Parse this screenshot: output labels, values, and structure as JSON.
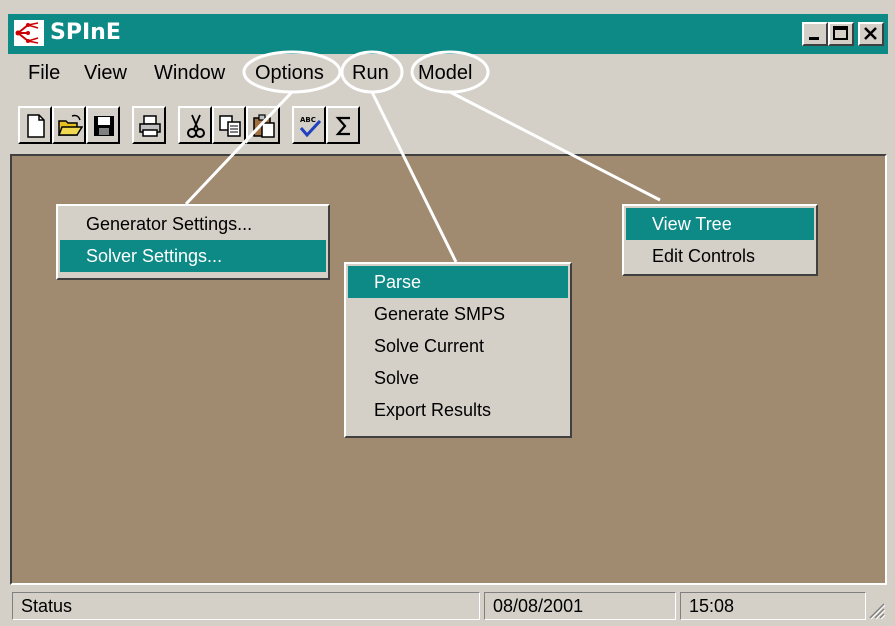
{
  "app": {
    "title": "SPInE"
  },
  "menubar": {
    "file": "File",
    "view": "View",
    "window": "Window",
    "options": "Options",
    "run": "Run",
    "model": "Model"
  },
  "toolbar": {
    "icons": [
      "new-icon",
      "open-icon",
      "save-icon",
      "print-icon",
      "cut-icon",
      "copy-icon",
      "paste-icon",
      "spellcheck-icon",
      "sum-icon"
    ]
  },
  "options_menu": {
    "items": [
      "Generator Settings...",
      "Solver Settings..."
    ],
    "selected": 1
  },
  "run_menu": {
    "items": [
      "Parse",
      "Generate SMPS",
      "Solve Current",
      "Solve",
      "Export Results"
    ],
    "selected": 0
  },
  "model_menu": {
    "items": [
      "View Tree",
      "Edit Controls"
    ],
    "selected": 0
  },
  "statusbar": {
    "status": "Status",
    "date": "08/08/2001",
    "time": "15:08"
  },
  "colors": {
    "title_bg": "#0e8a86",
    "client_bg": "#a08a70",
    "highlight": "#0e8a86",
    "face": "#d4d0c8"
  }
}
